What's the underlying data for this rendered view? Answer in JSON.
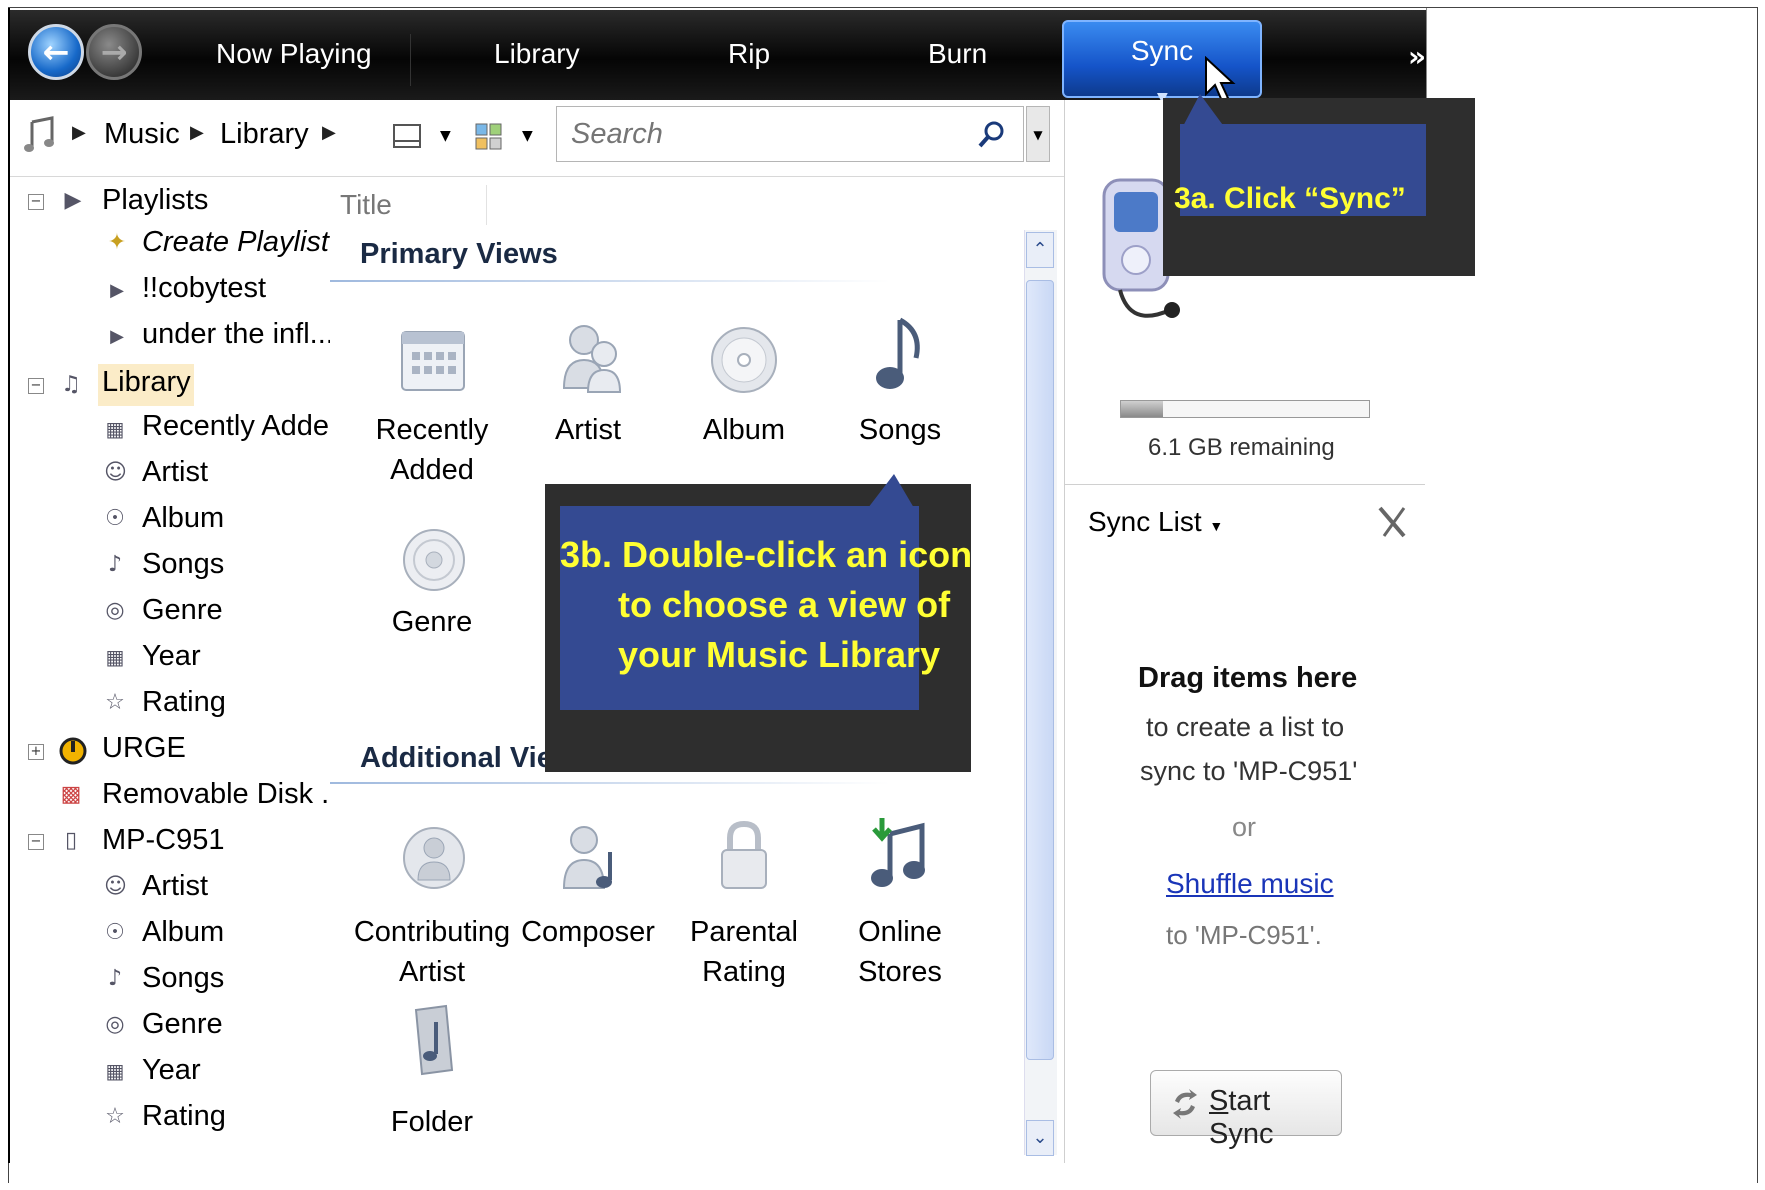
{
  "nav": {
    "tabs": [
      {
        "label": "Now Playing"
      },
      {
        "label": "Library"
      },
      {
        "label": "Rip"
      },
      {
        "label": "Burn"
      },
      {
        "label": "Sync"
      }
    ],
    "more": "»"
  },
  "breadcrumb": {
    "items": [
      "Music",
      "Library"
    ]
  },
  "search": {
    "placeholder": "Search"
  },
  "tree": {
    "playlists": "Playlists",
    "create_playlist": "Create Playlist",
    "p1": "!!cobytest",
    "p2": "under the infl...",
    "library": "Library",
    "recently_added": "Recently Added",
    "artist": "Artist",
    "album": "Album",
    "songs": "Songs",
    "genre": "Genre",
    "year": "Year",
    "rating": "Rating",
    "urge": "URGE",
    "removable": "Removable Disk ...",
    "device": "MP-C951",
    "d_artist": "Artist",
    "d_album": "Album",
    "d_songs": "Songs",
    "d_genre": "Genre",
    "d_year": "Year",
    "d_rating": "Rating"
  },
  "content": {
    "column_title": "Title",
    "primary_views": "Primary Views",
    "additional_views": "Additional Vie",
    "primary": [
      {
        "l1": "Recently",
        "l2": "Added"
      },
      {
        "l1": "Artist",
        "l2": ""
      },
      {
        "l1": "Album",
        "l2": ""
      },
      {
        "l1": "Songs",
        "l2": ""
      },
      {
        "l1": "Genre",
        "l2": ""
      }
    ],
    "additional": [
      {
        "l1": "Contributing",
        "l2": "Artist"
      },
      {
        "l1": "Composer",
        "l2": ""
      },
      {
        "l1": "Parental",
        "l2": "Rating"
      },
      {
        "l1": "Online",
        "l2": "Stores"
      },
      {
        "l1": "Folder",
        "l2": ""
      }
    ]
  },
  "sync_pane": {
    "remaining": "6.1 GB remaining",
    "storage_used_fraction": 0.17,
    "sync_list": "Sync List",
    "drag_title": "Drag items here",
    "drag_line1": "to create a list to",
    "drag_line2": "sync to 'MP-C951'",
    "or": "or",
    "shuffle": "Shuffle music",
    "shuffle_to": "to 'MP-C951'.",
    "start_sync_prefix": "S",
    "start_sync_rest": "tart Sync"
  },
  "callouts": {
    "a": "3a. Click “Sync”",
    "b1": "3b. Double-click an icon",
    "b2": "to choose a view of",
    "b3": "your Music Library"
  },
  "colors": {
    "accent": "#1554c9",
    "callout_bg": "#344a92",
    "callout_text": "#ffff33"
  }
}
